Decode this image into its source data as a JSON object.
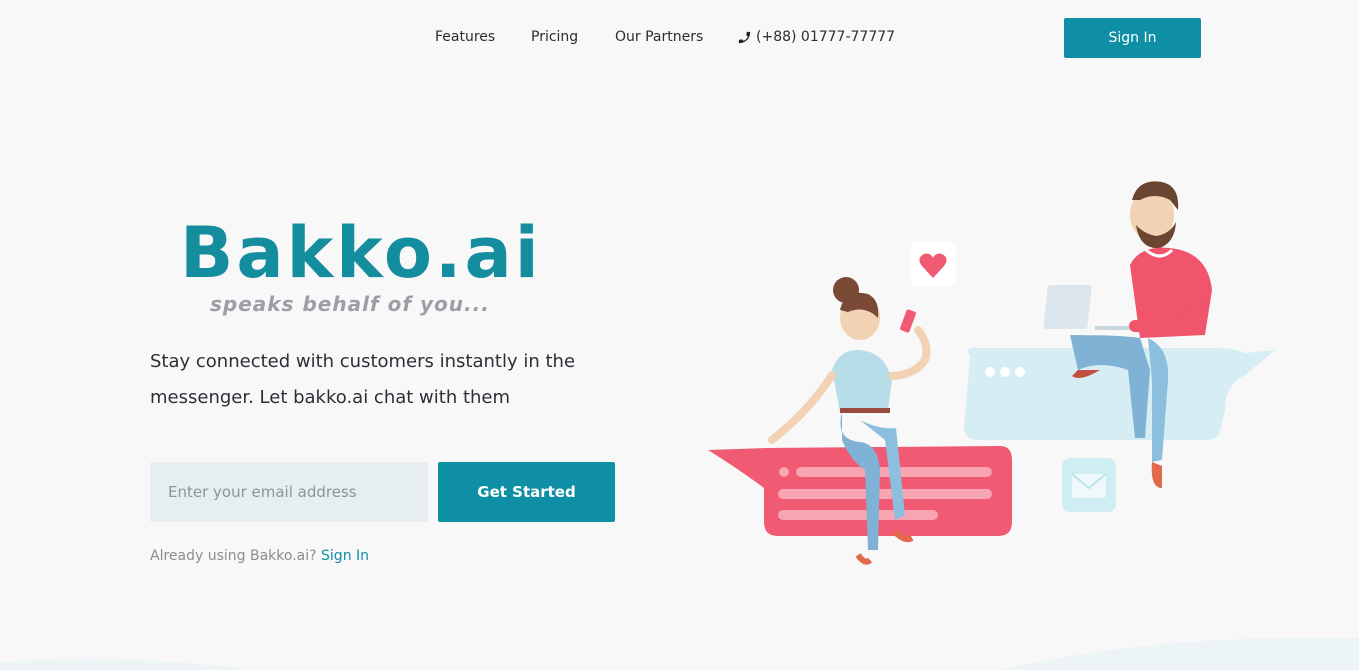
{
  "nav": {
    "features": "Features",
    "pricing": "Pricing",
    "partners": "Our Partners",
    "phone": "(+88) 01777-77777",
    "signin": "Sign In"
  },
  "hero": {
    "logo_text": "Bakko.ai",
    "tagline": "speaks behalf of you...",
    "description": "Stay connected with customers instantly in the messenger. Let bakko.ai chat with them",
    "email_placeholder": "Enter your email address",
    "cta": "Get Started",
    "already_text": "Already using Bakko.ai?",
    "already_link": "Sign In"
  },
  "colors": {
    "accent": "#0e8fa6",
    "background": "#f8f8f8"
  }
}
